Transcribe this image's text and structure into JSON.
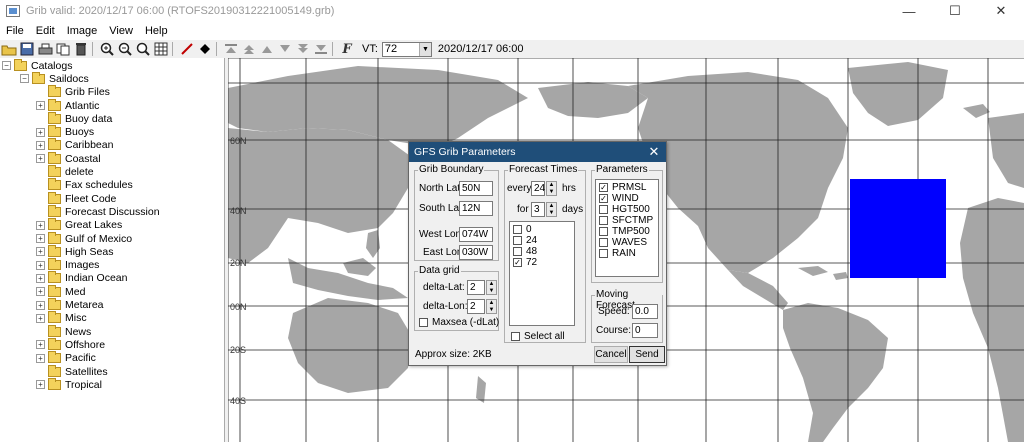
{
  "window": {
    "title": "Grib valid: 2020/12/17 06:00 (RTOFS20190312221005149.grb)",
    "minimize": "—",
    "maximize": "☐",
    "close": "✕"
  },
  "menu": [
    "File",
    "Edit",
    "Image",
    "View",
    "Help"
  ],
  "toolbar": {
    "vt_label": "VT:",
    "vt_value": "72",
    "vt_date": "2020/12/17 06:00"
  },
  "tree": {
    "root": "Catalogs",
    "saildocs": "Saildocs",
    "items": [
      {
        "label": "Grib Files",
        "expander": false
      },
      {
        "label": "Atlantic",
        "expander": true
      },
      {
        "label": "Buoy data",
        "expander": false
      },
      {
        "label": "Buoys",
        "expander": true
      },
      {
        "label": "Caribbean",
        "expander": true
      },
      {
        "label": "Coastal",
        "expander": true
      },
      {
        "label": "delete",
        "expander": false
      },
      {
        "label": "Fax schedules",
        "expander": false
      },
      {
        "label": "Fleet Code",
        "expander": false
      },
      {
        "label": "Forecast Discussion",
        "expander": false
      },
      {
        "label": "Great Lakes",
        "expander": true
      },
      {
        "label": "Gulf of Mexico",
        "expander": true
      },
      {
        "label": "High Seas",
        "expander": true
      },
      {
        "label": "Images",
        "expander": true
      },
      {
        "label": "Indian Ocean",
        "expander": true
      },
      {
        "label": "Med",
        "expander": true
      },
      {
        "label": "Metarea",
        "expander": true
      },
      {
        "label": "Misc",
        "expander": true
      },
      {
        "label": "News",
        "expander": false
      },
      {
        "label": "Offshore",
        "expander": true
      },
      {
        "label": "Pacific",
        "expander": true
      },
      {
        "label": "Satellites",
        "expander": false
      },
      {
        "label": "Tropical",
        "expander": true
      }
    ]
  },
  "map": {
    "lat_labels": [
      "60N",
      "40N",
      "20N",
      "00N",
      "20S",
      "40S"
    ],
    "selection_color": "#0000ff",
    "land_color": "#a6a6a6"
  },
  "dialog": {
    "title": "GFS Grib Parameters",
    "close": "✕",
    "boundary": {
      "title": "Grib Boundary",
      "north_label": "North Lat:",
      "north_value": "50N",
      "south_label": "South Lat:",
      "south_value": "12N",
      "west_label": "West Lon:",
      "west_value": "074W",
      "east_label": "East Lon:",
      "east_value": "030W"
    },
    "datagrid": {
      "title": "Data grid",
      "dlat_label": "delta-Lat:",
      "dlat_value": "2",
      "dlon_label": "delta-Lon:",
      "dlon_value": "2",
      "maxsea_label": "Maxsea (-dLat)"
    },
    "forecast": {
      "title": "Forecast Times",
      "every_label": "every",
      "every_value": "24",
      "hrs_label": "hrs",
      "for_label": "for",
      "for_value": "3",
      "days_label": "days",
      "times": [
        {
          "label": "0",
          "checked": false
        },
        {
          "label": "24",
          "checked": false
        },
        {
          "label": "48",
          "checked": false
        },
        {
          "label": "72",
          "checked": true
        }
      ],
      "select_all": "Select all"
    },
    "params": {
      "title": "Parameters",
      "items": [
        {
          "label": "PRMSL",
          "checked": true
        },
        {
          "label": "WIND",
          "checked": true
        },
        {
          "label": "HGT500",
          "checked": false
        },
        {
          "label": "SFCTMP",
          "checked": false
        },
        {
          "label": "TMP500",
          "checked": false
        },
        {
          "label": "WAVES",
          "checked": false
        },
        {
          "label": "RAIN",
          "checked": false
        }
      ]
    },
    "moving": {
      "title": "Moving Forecast",
      "speed_label": "Speed:",
      "speed_value": "0.0",
      "course_label": "Course:",
      "course_value": "0"
    },
    "approx": "Approx size: 2KB",
    "cancel": "Cancel",
    "send": "Send"
  }
}
